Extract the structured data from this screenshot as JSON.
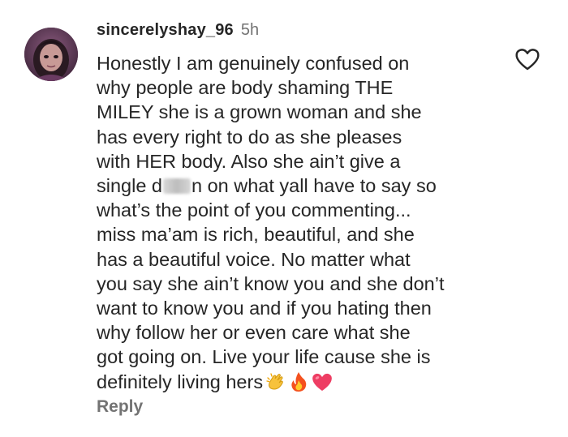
{
  "comment": {
    "username": "sincerelyshay_96",
    "time": "5h",
    "lines": [
      "Honestly I am genuinely confused on",
      "why people are body shaming THE",
      "MILEY she is a grown woman and she",
      "has every right to do as she pleases",
      "with HER body. Also she ain’t give a",
      {
        "before": "single d",
        "after": "n on what yall have to say so"
      },
      "what’s the point of you commenting...",
      "miss ma’am is rich, beautiful, and she",
      "has a beautiful voice. No matter what",
      "you say she ain’t know you and she don’t",
      "want to know you and if you hating then",
      "why follow her or even care what she",
      "got going on. Live your life cause she is",
      "definitely living hers"
    ],
    "emojis": [
      "clapping-hands-icon",
      "fire-icon",
      "heart-icon"
    ],
    "reply_label": "Reply"
  },
  "icons": {
    "like": "heart-outline-icon",
    "avatar": "avatar"
  },
  "colors": {
    "text": "#262626",
    "secondary": "#737373",
    "background": "#ffffff"
  }
}
